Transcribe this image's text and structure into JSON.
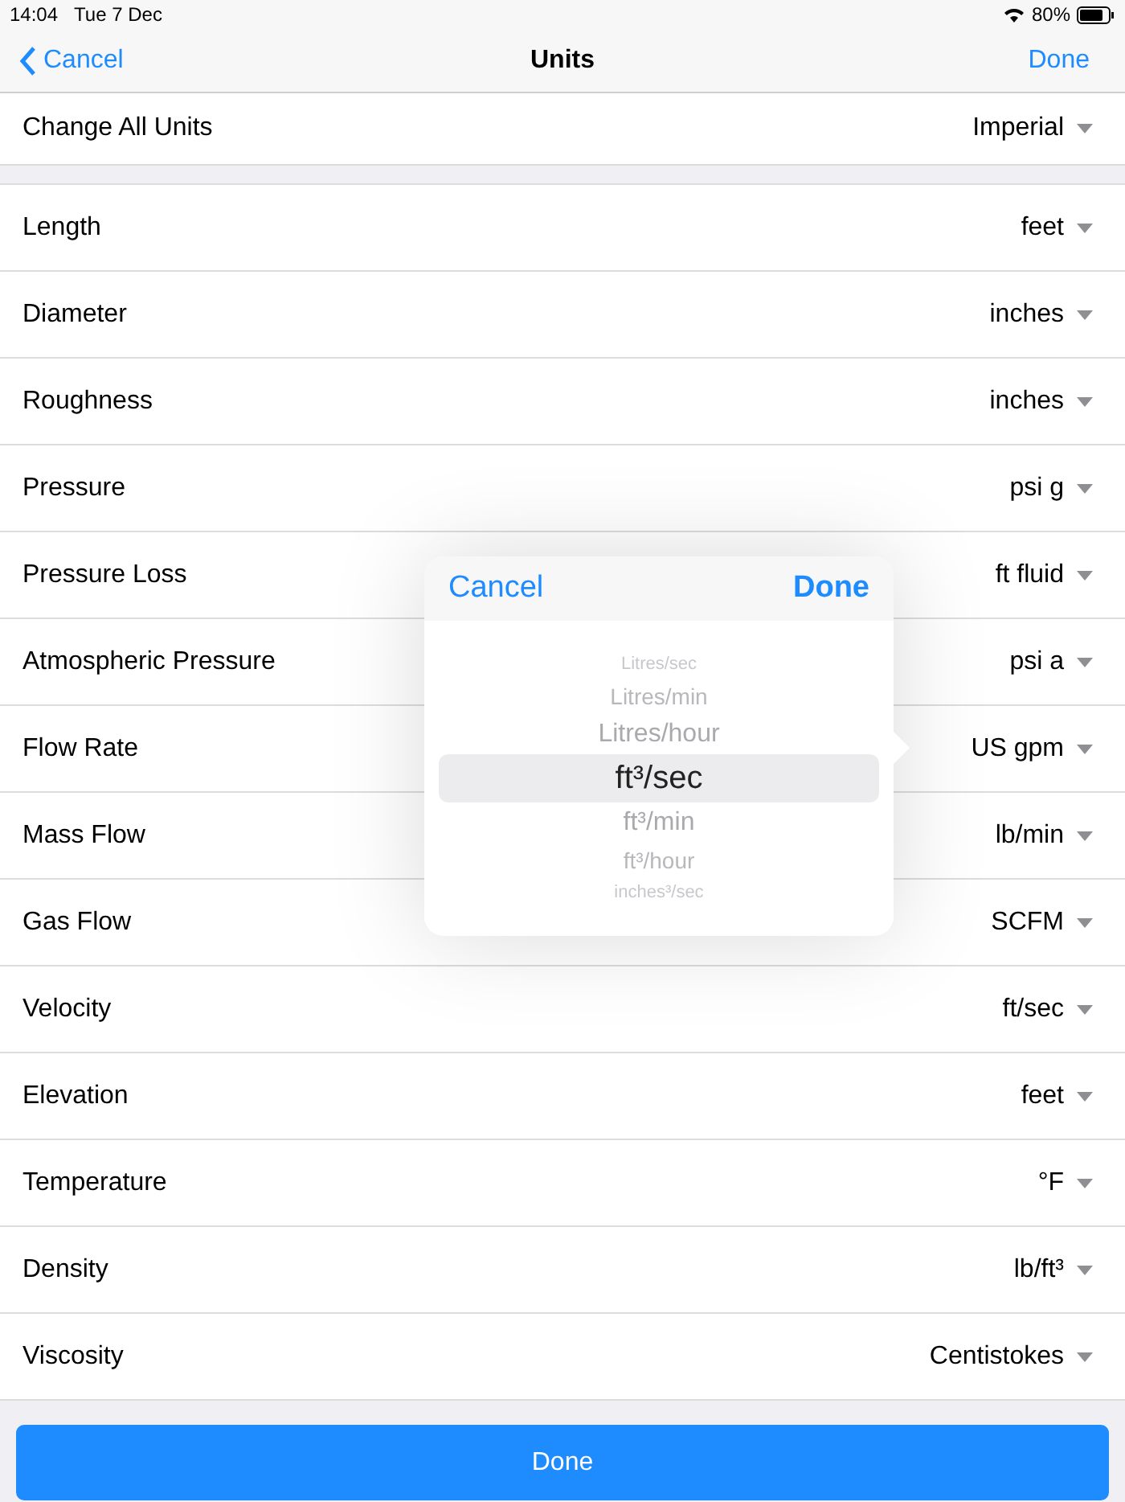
{
  "status_bar": {
    "time": "14:04",
    "date": "Tue 7 Dec",
    "battery": "80%"
  },
  "nav": {
    "cancel": "Cancel",
    "title": "Units",
    "done": "Done"
  },
  "change_all": {
    "label": "Change All Units",
    "value": "Imperial"
  },
  "rows": [
    {
      "label": "Length",
      "value": "feet"
    },
    {
      "label": "Diameter",
      "value": "inches"
    },
    {
      "label": "Roughness",
      "value": "inches"
    },
    {
      "label": "Pressure",
      "value": "psi g"
    },
    {
      "label": "Pressure Loss",
      "value": "ft fluid"
    },
    {
      "label": "Atmospheric Pressure",
      "value": "psi a"
    },
    {
      "label": "Flow Rate",
      "value": "US gpm"
    },
    {
      "label": "Mass Flow",
      "value": "lb/min"
    },
    {
      "label": "Gas Flow",
      "value": "SCFM"
    },
    {
      "label": "Velocity",
      "value": "ft/sec"
    },
    {
      "label": "Elevation",
      "value": "feet"
    },
    {
      "label": "Temperature",
      "value": "°F"
    },
    {
      "label": "Density",
      "value": "lb/ft³"
    },
    {
      "label": "Viscosity",
      "value": "Centistokes"
    }
  ],
  "popover": {
    "cancel": "Cancel",
    "done": "Done",
    "options": [
      {
        "label": "Litres/sec",
        "selected": false
      },
      {
        "label": "Litres/min",
        "selected": false
      },
      {
        "label": "Litres/hour",
        "selected": false
      },
      {
        "label": "ft³/sec",
        "selected": true
      },
      {
        "label": "ft³/min",
        "selected": false
      },
      {
        "label": "ft³/hour",
        "selected": false
      },
      {
        "label": "inches³/sec",
        "selected": false
      }
    ]
  },
  "done_button": "Done"
}
